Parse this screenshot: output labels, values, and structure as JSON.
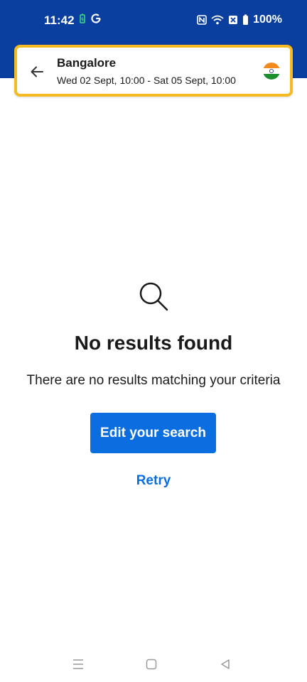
{
  "status_bar": {
    "time": "11:42",
    "battery_text": "100%",
    "icons": [
      "battery-saver-icon",
      "google-icon",
      "nfc-icon",
      "wifi-icon",
      "sim-off-icon",
      "battery-icon"
    ]
  },
  "search_card": {
    "location": "Bangalore",
    "dates": "Wed 02 Sept, 10:00 - Sat 05 Sept, 10:00",
    "back_icon": "arrow-left-icon",
    "flag_icon": "india-flag-icon",
    "border_color": "#f5b921"
  },
  "empty_state": {
    "icon": "search-icon",
    "title": "No results found",
    "description": "There are no results matching your criteria"
  },
  "actions": {
    "edit_label": "Edit your search",
    "retry_label": "Retry"
  },
  "nav_bar": {
    "items": [
      "menu-icon",
      "home-icon",
      "back-icon"
    ]
  },
  "colors": {
    "header": "#0a3fa0",
    "primary": "#0a6ee0",
    "highlight": "#f5b921"
  }
}
